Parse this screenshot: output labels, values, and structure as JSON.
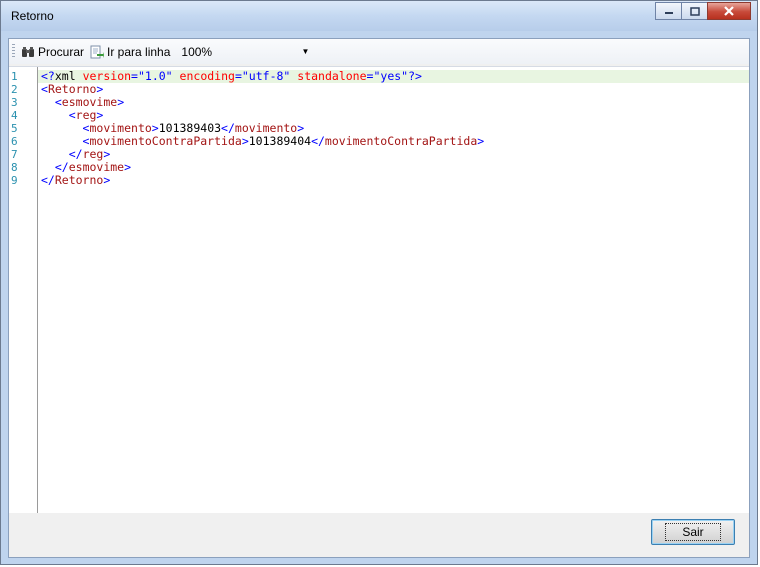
{
  "window": {
    "title": "Retorno"
  },
  "toolbar": {
    "procurar_label": "Procurar",
    "ir_para_linha_label": "Ir para linha",
    "zoom_value": "100%"
  },
  "editor": {
    "line_numbers": [
      "1",
      "2",
      "3",
      "4",
      "5",
      "6",
      "7",
      "8",
      "9"
    ],
    "decl": {
      "open": "<?",
      "name": "xml",
      "attr1": "version",
      "val1": "\"1.0\"",
      "attr2": "encoding",
      "val2": "\"utf-8\"",
      "attr3": "standalone",
      "val3": "\"yes\"",
      "close": "?>"
    },
    "tags": {
      "retorno": "Retorno",
      "esmovime": "esmovime",
      "reg": "reg",
      "movimento": "movimento",
      "contra": "movimentoContraPartida"
    },
    "values": {
      "movimento": "101389403",
      "contra": "101389404"
    }
  },
  "footer": {
    "sair_label": "Sair"
  },
  "colors": {
    "tag": "#0000ff",
    "tagname": "#a31515",
    "attr": "#ff0000",
    "line_number": "#2b91af",
    "current_line": "#e8f5e1"
  }
}
